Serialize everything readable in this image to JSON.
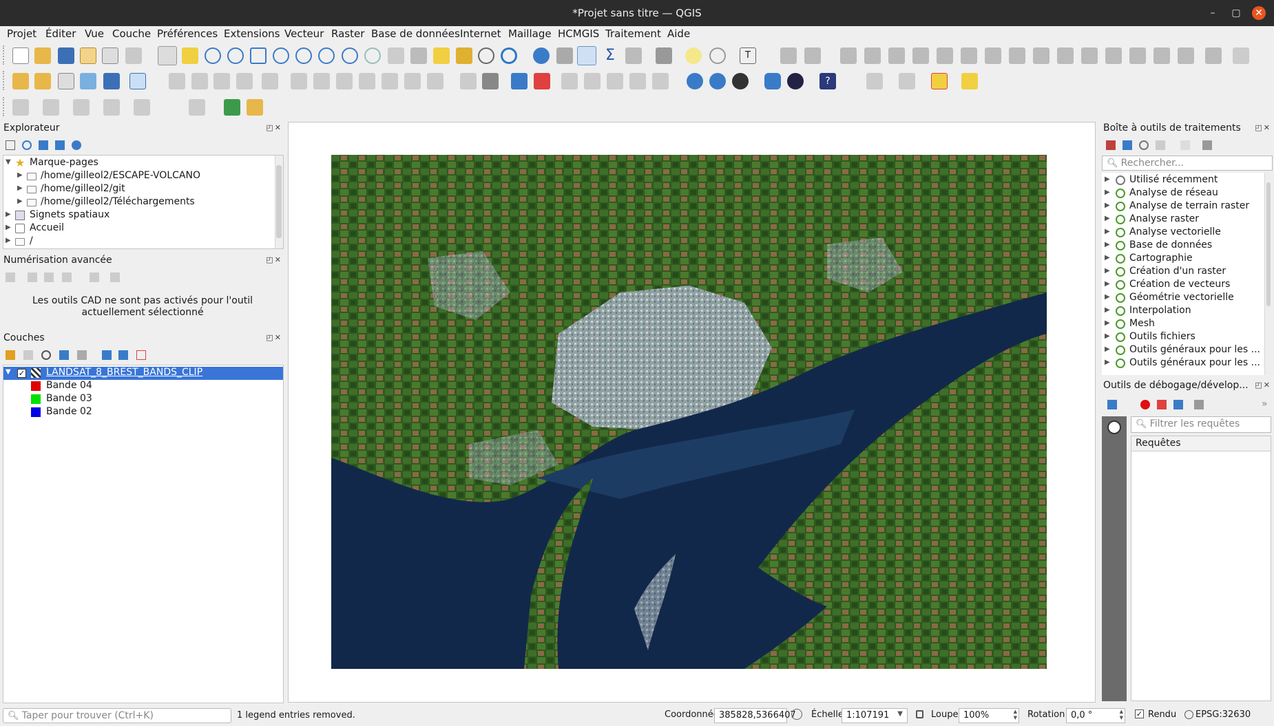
{
  "window": {
    "title": "*Projet sans titre — QGIS",
    "controls": [
      "–",
      "▢",
      "✕"
    ]
  },
  "menu": [
    "Projet",
    "Éditer",
    "Vue",
    "Couche",
    "Préférences",
    "Extensions",
    "Vecteur",
    "Raster",
    "Base de données",
    "Internet",
    "Maillage",
    "HCMGIS",
    "Traitement",
    "Aide"
  ],
  "browser": {
    "title": "Explorateur",
    "items": [
      {
        "label": "Marque-pages",
        "expanded": true
      },
      {
        "label": "/home/gilleol2/ESCAPE-VOLCANO"
      },
      {
        "label": "/home/gilleol2/git"
      },
      {
        "label": "/home/gilleol2/Téléchargements"
      },
      {
        "label": "Signets spatiaux"
      },
      {
        "label": "Accueil"
      },
      {
        "label": "/"
      }
    ]
  },
  "digitizing": {
    "title": "Numérisation avancée",
    "message": "Les outils CAD ne sont pas activés pour l'outil actuellement sélectionné"
  },
  "layers": {
    "title": "Couches",
    "layer": "LANDSAT_8_BREST_BANDS_CLIP",
    "checked": true,
    "bands": [
      {
        "label": "Bande 04",
        "color": "#e00000"
      },
      {
        "label": "Bande 03",
        "color": "#00e000"
      },
      {
        "label": "Bande 02",
        "color": "#0000e8"
      }
    ]
  },
  "processing": {
    "title": "Boîte à outils de traitements",
    "search_placeholder": "Rechercher...",
    "items": [
      "Utilisé récemment",
      "Analyse de réseau",
      "Analyse de terrain raster",
      "Analyse raster",
      "Analyse vectorielle",
      "Base de données",
      "Cartographie",
      "Création d'un raster",
      "Création de vecteurs",
      "Géométrie vectorielle",
      "Interpolation",
      "Mesh",
      "Outils fichiers",
      "Outils généraux pour les ...",
      "Outils généraux pour les ..."
    ]
  },
  "debug": {
    "title": "Outils de débogage/dévelop...",
    "filter_placeholder": "Filtrer les requêtes",
    "header": "Requêtes"
  },
  "status": {
    "locator_placeholder": "Taper pour trouver (Ctrl+K)",
    "message": "1 legend entries removed.",
    "coord_label": "Coordonnée",
    "coord_value": "385828,5366407",
    "scale_label": "Échelle",
    "scale_value": "1:107191",
    "magnifier_label": "Loupe",
    "magnifier_value": "100%",
    "rotation_label": "Rotation",
    "rotation_value": "0,0 °",
    "render_label": "Rendu",
    "crs": "EPSG:32630"
  },
  "colors": {
    "accent": "#3875d7",
    "qgis_green": "#4b9a2a"
  }
}
